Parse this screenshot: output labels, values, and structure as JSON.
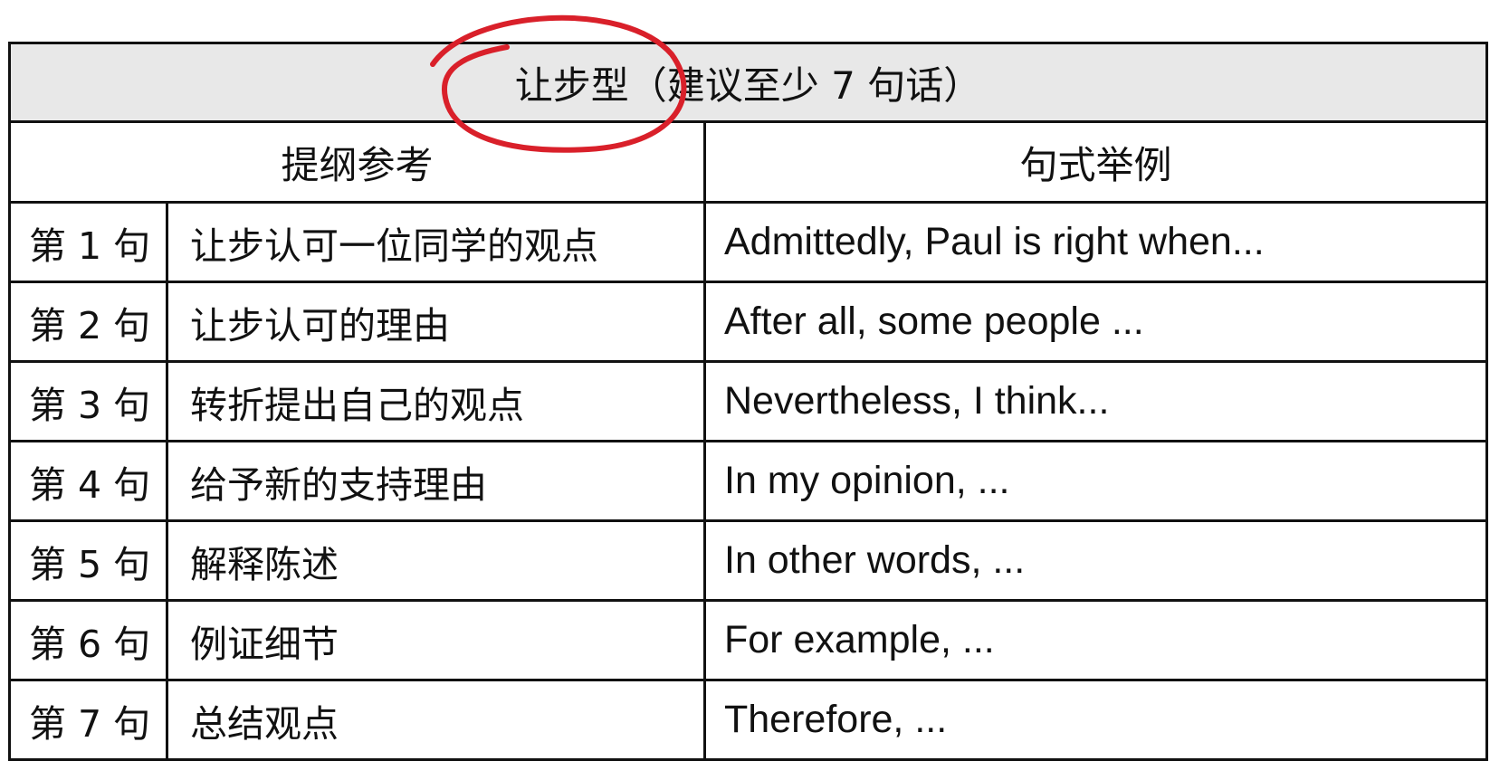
{
  "table": {
    "title": "让步型（建议至少 7 句话）",
    "headers": {
      "outline": "提纲参考",
      "examples": "句式举例"
    },
    "rows": [
      {
        "num": "第 1 句",
        "outline": "让步认可一位同学的观点",
        "example": "Admittedly, Paul is right when..."
      },
      {
        "num": "第 2 句",
        "outline": "让步认可的理由",
        "example": "After all, some people ..."
      },
      {
        "num": "第 3 句",
        "outline": "转折提出自己的观点",
        "example": "Nevertheless, I think..."
      },
      {
        "num": "第 4 句",
        "outline": "给予新的支持理由",
        "example": "In my opinion, ..."
      },
      {
        "num": "第 5 句",
        "outline": "解释陈述",
        "example": "In other words, ..."
      },
      {
        "num": "第 6 句",
        "outline": "例证细节",
        "example": "For example, ..."
      },
      {
        "num": "第 7 句",
        "outline": "总结观点",
        "example": "Therefore, ..."
      }
    ]
  },
  "annotation": {
    "circle_color": "#d9202a"
  }
}
